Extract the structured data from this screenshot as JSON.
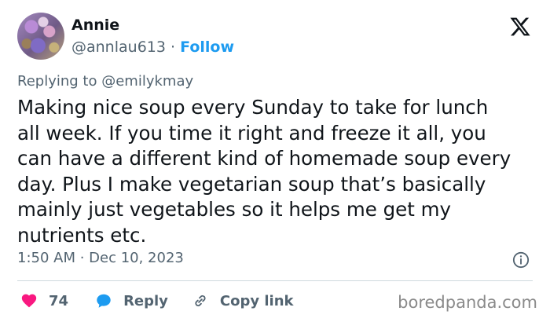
{
  "author": {
    "name": "Annie",
    "handle": "@annlau613",
    "separator": "·",
    "follow_label": "Follow"
  },
  "header": {
    "logo_icon": "x-logo-icon"
  },
  "reply_context": {
    "prefix": "Replying to",
    "target": "@emilykmay"
  },
  "tweet": {
    "text": "Making nice soup every Sunday to take for lunch\nall week. If you time it right and  freeze it all, you\ncan have a different kind of homemade soup every\nday. Plus I make vegetarian soup that’s basically\nmainly just vegetables so it helps me get my\nnutrients etc.",
    "timestamp": "1:50 AM · Dec 10, 2023"
  },
  "actions": {
    "like_count": "74",
    "reply_label": "Reply",
    "copy_link_label": "Copy link"
  },
  "watermark": "boredpanda.com",
  "colors": {
    "accent": "#1d9bf0",
    "like": "#f91880",
    "reply_icon": "#1d9bf0",
    "muted": "#536471",
    "text": "#0f1419"
  }
}
